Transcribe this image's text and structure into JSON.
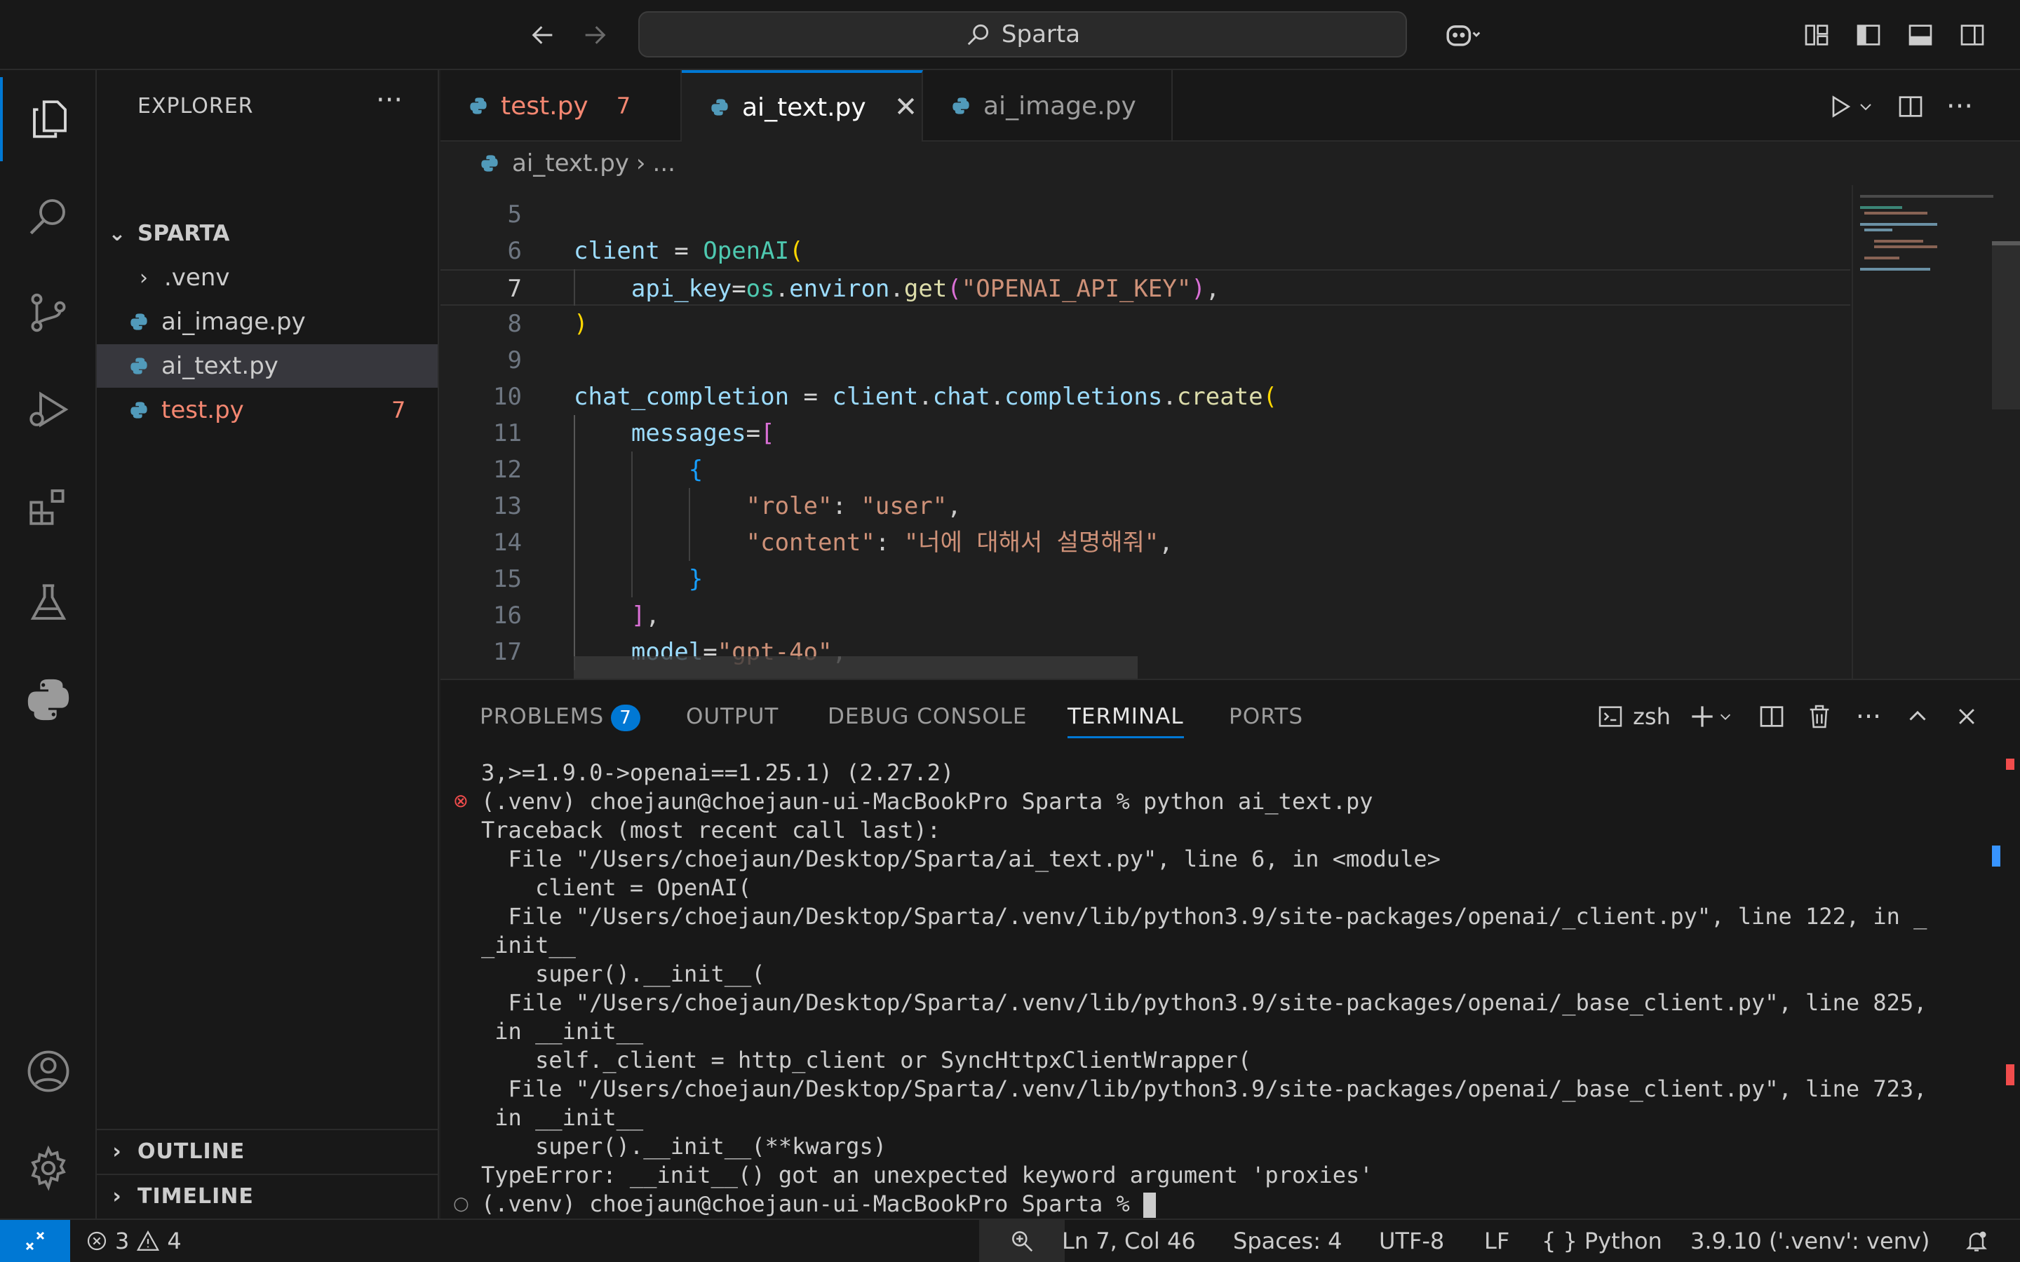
{
  "titlebar": {
    "search_text": "Sparta",
    "back_icon": "arrow-left-icon",
    "forward_icon": "arrow-right-icon",
    "copilot_icon": "copilot-icon"
  },
  "activitybar": {
    "items": [
      "explorer-icon",
      "search-icon",
      "source-control-icon",
      "run-debug-icon",
      "extensions-icon",
      "testing-icon",
      "python-icon"
    ],
    "bottom": [
      "account-icon",
      "settings-gear-icon"
    ]
  },
  "sidebar": {
    "title": "EXPLORER",
    "more": "···",
    "folder": "SPARTA",
    "items": [
      {
        "name": ".venv",
        "type": "folder"
      },
      {
        "name": "ai_image.py",
        "type": "file"
      },
      {
        "name": "ai_text.py",
        "type": "file"
      },
      {
        "name": "test.py",
        "type": "file",
        "errors": "7"
      }
    ],
    "outline": "OUTLINE",
    "timeline": "TIMELINE"
  },
  "tabs": [
    {
      "label": "test.py",
      "badge": "7"
    },
    {
      "label": "ai_text.py",
      "close": "✕"
    },
    {
      "label": "ai_image.py"
    }
  ],
  "breadcrumb": {
    "file": "ai_text.py",
    "sep": "›",
    "rest": "..."
  },
  "editor": {
    "line_numbers": [
      "5",
      "6",
      "7",
      "8",
      "9",
      "10",
      "11",
      "12",
      "13",
      "14",
      "15",
      "16",
      "17"
    ],
    "line6": {
      "var": "client",
      "eq": " = ",
      "cls": "OpenAI",
      "br": "("
    },
    "line7": {
      "indent": "    ",
      "var": "api_key",
      "eq": "=",
      "mod": "os",
      "dot1": ".",
      "attr": "environ",
      "dot2": ".",
      "fn": "get",
      "br1": "(",
      "str": "\"OPENAI_API_KEY\"",
      "br2": ")",
      "comma": ","
    },
    "line8": {
      "br": ")"
    },
    "line10": {
      "var": "chat_completion",
      "eq": " = ",
      "a": "client",
      "d1": ".",
      "b": "chat",
      "d2": ".",
      "c": "completions",
      "d3": ".",
      "fn": "create",
      "br": "("
    },
    "line11": {
      "indent": "    ",
      "var": "messages",
      "eq": "=",
      "br": "["
    },
    "line12": {
      "indent": "        ",
      "br": "{"
    },
    "line13": {
      "indent": "            ",
      "key": "\"role\"",
      "colon": ": ",
      "val": "\"user\"",
      "comma": ","
    },
    "line14": {
      "indent": "            ",
      "key": "\"content\"",
      "colon": ": ",
      "val": "\"너에 대해서 설명해줘\"",
      "comma": ","
    },
    "line15": {
      "indent": "        ",
      "br": "}"
    },
    "line16": {
      "indent": "    ",
      "br": "]",
      "comma": ","
    },
    "line17": {
      "indent": "    ",
      "var": "model",
      "eq": "=",
      "str": "\"gpt-4o\"",
      "comma": ","
    }
  },
  "panel": {
    "tabs": [
      "PROBLEMS",
      "OUTPUT",
      "DEBUG CONSOLE",
      "TERMINAL",
      "PORTS"
    ],
    "problems_count": "7",
    "shell": "zsh",
    "terminal_lines": [
      "3,>=1.9.0->openai==1.25.1) (2.27.2)",
      "(.venv) choejaun@choejaun-ui-MacBookPro Sparta % python ai_text.py",
      "Traceback (most recent call last):",
      "  File \"/Users/choejaun/Desktop/Sparta/ai_text.py\", line 6, in <module>",
      "    client = OpenAI(",
      "  File \"/Users/choejaun/Desktop/Sparta/.venv/lib/python3.9/site-packages/openai/_client.py\", line 122, in _",
      "_init__",
      "    super().__init__(",
      "  File \"/Users/choejaun/Desktop/Sparta/.venv/lib/python3.9/site-packages/openai/_base_client.py\", line 825,",
      " in __init__",
      "    self._client = http_client or SyncHttpxClientWrapper(",
      "  File \"/Users/choejaun/Desktop/Sparta/.venv/lib/python3.9/site-packages/openai/_base_client.py\", line 723,",
      " in __init__",
      "    super().__init__(**kwargs)",
      "TypeError: __init__() got an unexpected keyword argument 'proxies'",
      "(.venv) choejaun@choejaun-ui-MacBookPro Sparta % "
    ]
  },
  "statusbar": {
    "errors": "3",
    "warnings": "4",
    "position": "Ln 7, Col 46",
    "spaces": "Spaces: 4",
    "encoding": "UTF-8",
    "eol": "LF",
    "braces": "{ }",
    "language": "Python",
    "interpreter": "3.9.10 ('.venv': venv)"
  },
  "colors": {
    "accent": "#0078d4",
    "error": "#f48771",
    "background": "#1f1f1f"
  }
}
